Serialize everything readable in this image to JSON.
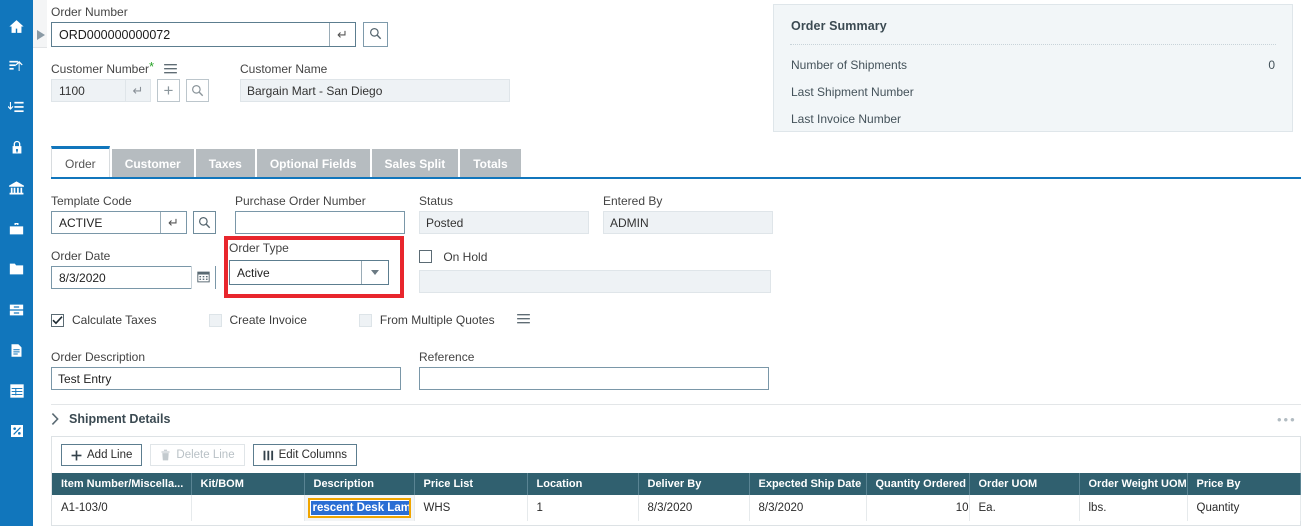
{
  "sidebar": {
    "items": [
      {
        "icon": "home-icon",
        "name": "home"
      },
      {
        "icon": "sort-ascending-icon",
        "name": "sort-ascending"
      },
      {
        "icon": "list-insert-icon",
        "name": "list-insert"
      },
      {
        "icon": "lock-icon",
        "name": "lock"
      },
      {
        "icon": "bank-icon",
        "name": "bank"
      },
      {
        "icon": "briefcase-icon",
        "name": "briefcase"
      },
      {
        "icon": "folder-icon",
        "name": "folder"
      },
      {
        "icon": "archive-icon",
        "name": "archive"
      },
      {
        "icon": "document-icon",
        "name": "document"
      },
      {
        "icon": "table-icon",
        "name": "table"
      },
      {
        "icon": "percent-icon",
        "name": "percent"
      }
    ],
    "collapse_arrow": "collapse-arrow-icon"
  },
  "order_number": {
    "label": "Order Number",
    "value": "ORD000000000072",
    "placeholder": "",
    "enter_icon": "enter-key-icon",
    "search_icon": "search-icon"
  },
  "customer_number": {
    "label": "Customer Number",
    "required_marker": "*",
    "menu_icon": "hamburger-menu-icon",
    "value": "1100",
    "enter_icon": "enter-key-icon",
    "add_icon": "plus-icon",
    "search_icon": "search-icon"
  },
  "customer_name": {
    "label": "Customer Name",
    "value": "Bargain Mart - San Diego"
  },
  "order_summary": {
    "title": "Order Summary",
    "rows": [
      {
        "label": "Number of Shipments",
        "value": "0"
      },
      {
        "label": "Last Shipment Number",
        "value": ""
      },
      {
        "label": "Last Invoice Number",
        "value": ""
      }
    ]
  },
  "tabs": [
    {
      "label": "Order",
      "active": true
    },
    {
      "label": "Customer",
      "active": false
    },
    {
      "label": "Taxes",
      "active": false
    },
    {
      "label": "Optional Fields",
      "active": false
    },
    {
      "label": "Sales Split",
      "active": false
    },
    {
      "label": "Totals",
      "active": false
    }
  ],
  "form": {
    "template_code": {
      "label": "Template Code",
      "value": "ACTIVE",
      "enter_icon": "enter-key-icon",
      "search_icon": "search-icon"
    },
    "purchase_order_number": {
      "label": "Purchase Order Number",
      "value": ""
    },
    "status": {
      "label": "Status",
      "value": "Posted"
    },
    "entered_by": {
      "label": "Entered By",
      "value": "ADMIN"
    },
    "order_date": {
      "label": "Order Date",
      "value": "8/3/2020",
      "calendar_icon": "calendar-icon"
    },
    "order_type": {
      "label": "Order Type",
      "value": "Active",
      "caret_icon": "chevron-down-icon",
      "highlight_color": "#e8262d"
    },
    "on_hold": {
      "label": "On Hold",
      "checked": false,
      "value": ""
    },
    "checkboxes": [
      {
        "label": "Calculate Taxes",
        "checked": true,
        "disabled": false
      },
      {
        "label": "Create Invoice",
        "checked": false,
        "disabled": true
      },
      {
        "label": "From Multiple Quotes",
        "checked": false,
        "disabled": true
      }
    ],
    "quotes_menu_icon": "hamburger-menu-icon",
    "order_description": {
      "label": "Order Description",
      "value": "Test Entry"
    },
    "reference": {
      "label": "Reference",
      "value": ""
    }
  },
  "shipment_details": {
    "title": "Shipment Details",
    "chevron_icon": "chevron-right-icon",
    "overflow_icon": "ellipsis-icon",
    "toolbar": [
      {
        "label": "Add Line",
        "icon": "plus-icon",
        "disabled": false
      },
      {
        "label": "Delete Line",
        "icon": "trash-icon",
        "disabled": true
      },
      {
        "label": "Edit Columns",
        "icon": "columns-icon",
        "disabled": false
      }
    ],
    "table": {
      "columns": [
        "Item Number/Miscella...",
        "Kit/BOM",
        "Description",
        "Price List",
        "Location",
        "Deliver By",
        "Expected Ship Date",
        "Quantity Ordered",
        "Order UOM",
        "Order Weight UOM",
        "Price By"
      ],
      "rows": [
        {
          "item_number": "A1-103/0",
          "kit_bom": "",
          "description": "rescent Desk Lamp",
          "description_editing": true,
          "price_list": "WHS",
          "location": "1",
          "deliver_by": "8/3/2020",
          "expected_ship_date": "8/3/2020",
          "quantity_ordered": "10",
          "order_uom": "Ea.",
          "order_weight_uom": "lbs.",
          "price_by": "Quantity"
        }
      ]
    }
  },
  "colors": {
    "rail": "#1176bc",
    "accent": "#1176bc",
    "table_header": "#30606f",
    "highlight": "#e8262d",
    "edit_border": "#f0a500",
    "selection": "#2a6ed4"
  }
}
